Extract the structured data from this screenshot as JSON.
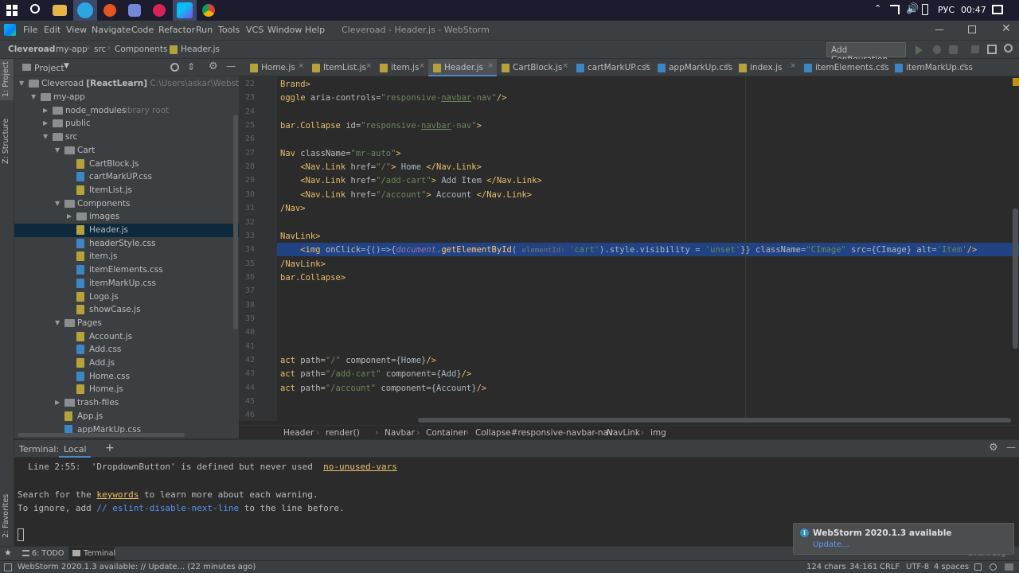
{
  "taskbar": {
    "lang": "РУС",
    "time": "00:47"
  },
  "menu": {
    "items": [
      "File",
      "Edit",
      "View",
      "Navigate",
      "Code",
      "Refactor",
      "Run",
      "Tools",
      "VCS",
      "Window",
      "Help"
    ],
    "title": "Cleveroad - Header.js - WebStorm"
  },
  "nav": {
    "crumbs": [
      "Cleveroad",
      "my-app",
      "src",
      "Components",
      "Header.js"
    ],
    "config_button": "Add Configuration..."
  },
  "side_left": {
    "project": "1: Project",
    "structure": "Z: Structure",
    "favorites": "2: Favorites"
  },
  "project": {
    "title": "Project",
    "root_name": "Cleveroad",
    "root_tag": "[ReactLearn]",
    "root_path": "C:\\Users\\askar\\WebstormProje",
    "lib_tag": "library root",
    "tree": [
      {
        "label": "my-app",
        "type": "folder",
        "indent": 1,
        "open": true
      },
      {
        "label": "node_modules",
        "type": "folder",
        "indent": 2,
        "open": false
      },
      {
        "label": "public",
        "type": "folder",
        "indent": 2,
        "open": false
      },
      {
        "label": "src",
        "type": "folder",
        "indent": 2,
        "open": true
      },
      {
        "label": "Cart",
        "type": "folder",
        "indent": 3,
        "open": true
      },
      {
        "label": "CartBlock.js",
        "type": "js",
        "indent": 4
      },
      {
        "label": "cartMarkUP.css",
        "type": "css",
        "indent": 4
      },
      {
        "label": "ItemList.js",
        "type": "js",
        "indent": 4
      },
      {
        "label": "Components",
        "type": "folder",
        "indent": 3,
        "open": true
      },
      {
        "label": "images",
        "type": "folder",
        "indent": 4,
        "open": false
      },
      {
        "label": "Header.js",
        "type": "js",
        "indent": 4,
        "selected": true
      },
      {
        "label": "headerStyle.css",
        "type": "css",
        "indent": 4
      },
      {
        "label": "item.js",
        "type": "js",
        "indent": 4
      },
      {
        "label": "itemElements.css",
        "type": "css",
        "indent": 4
      },
      {
        "label": "itemMarkUp.css",
        "type": "css",
        "indent": 4
      },
      {
        "label": "Logo.js",
        "type": "js",
        "indent": 4
      },
      {
        "label": "showCase.js",
        "type": "js",
        "indent": 4
      },
      {
        "label": "Pages",
        "type": "folder",
        "indent": 3,
        "open": true
      },
      {
        "label": "Account.js",
        "type": "js",
        "indent": 4
      },
      {
        "label": "Add.css",
        "type": "css",
        "indent": 4
      },
      {
        "label": "Add.js",
        "type": "js",
        "indent": 4
      },
      {
        "label": "Home.css",
        "type": "css",
        "indent": 4
      },
      {
        "label": "Home.js",
        "type": "js",
        "indent": 4
      },
      {
        "label": "trash-files",
        "type": "folder",
        "indent": 3,
        "open": false
      },
      {
        "label": "App.js",
        "type": "js",
        "indent": 3
      },
      {
        "label": "appMarkUp.css",
        "type": "css",
        "indent": 3
      }
    ]
  },
  "tabs": [
    {
      "label": "Home.js",
      "type": "js"
    },
    {
      "label": "ItemList.js",
      "type": "js"
    },
    {
      "label": "item.js",
      "type": "js"
    },
    {
      "label": "Header.js",
      "type": "js",
      "active": true
    },
    {
      "label": "CartBlock.js",
      "type": "js"
    },
    {
      "label": "cartMarkUP.css",
      "type": "css"
    },
    {
      "label": "appMarkUp.css",
      "type": "css"
    },
    {
      "label": "index.js",
      "type": "js"
    },
    {
      "label": "itemElements.css",
      "type": "css"
    },
    {
      "label": "itemMarkUp.css",
      "type": "css"
    }
  ],
  "code": {
    "lines": [
      "22",
      "23",
      "24",
      "25",
      "26",
      "27",
      "28",
      "29",
      "30",
      "31",
      "32",
      "33",
      "34",
      "35",
      "36",
      "37",
      "38",
      "39",
      "40",
      "41",
      "42",
      "43",
      "44",
      "45",
      "46"
    ]
  },
  "breadcrumbs": [
    "Header",
    "render()",
    "Navbar",
    "Container",
    "Collapse#responsive-navbar-nav",
    "NavLink",
    "img"
  ],
  "terminal": {
    "title": "Terminal:",
    "tab": "Local",
    "line1_pre": "  Line 2:55:  'DropdownButton' is defined but never used  ",
    "line1_link": "no-unused-vars",
    "line2_pre": "Search for the ",
    "line2_link": "keywords",
    "line2_post": " to learn more about each warning.",
    "line3_pre": "To ignore, add ",
    "line3_link": "// eslint-disable-next-line",
    "line3_post": " to the line before."
  },
  "bottom_tabs": {
    "todo": "6: TODO",
    "terminal": "Terminal",
    "event_log": "Event Log"
  },
  "notification": {
    "title": "WebStorm 2020.1.3 available",
    "link": "Update..."
  },
  "status": {
    "message": "WebStorm 2020.1.3 available: // Update... (22 minutes ago)",
    "chars": "124 chars",
    "pos": "34:161",
    "eol": "CRLF",
    "enc": "UTF-8",
    "indent": "4 spaces"
  }
}
